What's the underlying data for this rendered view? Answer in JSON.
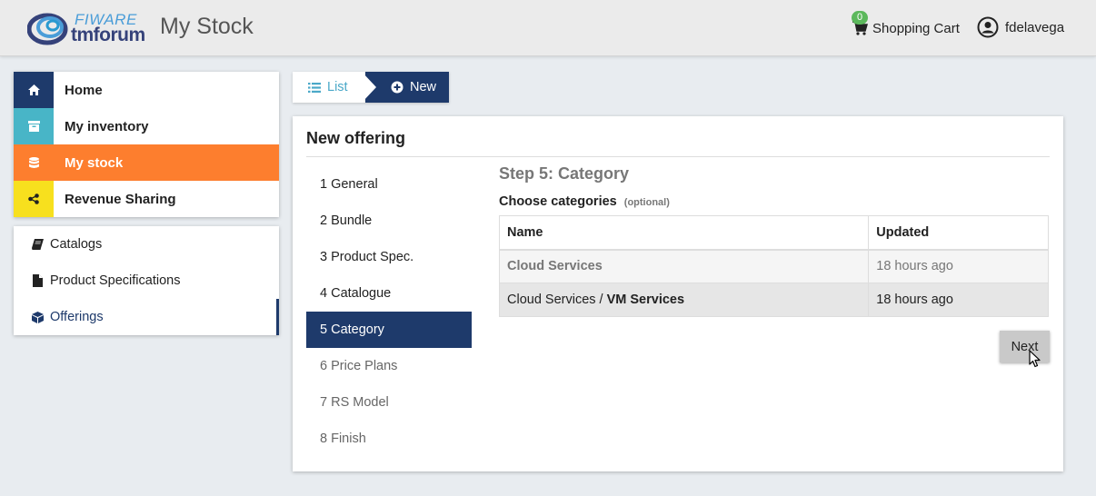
{
  "header": {
    "logo_top": "FIWARE",
    "logo_bottom": "tmforum",
    "title": "My Stock",
    "cart_count": "0",
    "cart_label": "Shopping Cart",
    "user_name": "fdelavega"
  },
  "sidebar": {
    "nav": [
      {
        "label": "Home",
        "icon": "home-icon",
        "color": "#1e3a6b"
      },
      {
        "label": "My inventory",
        "icon": "archive-icon",
        "color": "#48b5c7"
      },
      {
        "label": "My stock",
        "icon": "database-icon",
        "color": "#fd7e2e"
      },
      {
        "label": "Revenue Sharing",
        "icon": "share-icon",
        "color": "#f7e01e"
      }
    ],
    "sub": [
      {
        "label": "Catalogs",
        "icon": "book-icon"
      },
      {
        "label": "Product Specifications",
        "icon": "file-icon"
      },
      {
        "label": "Offerings",
        "icon": "cube-icon"
      }
    ]
  },
  "breadcrumb": {
    "list_label": "List",
    "new_label": "New"
  },
  "panel": {
    "title": "New offering",
    "steps": [
      "1 General",
      "2 Bundle",
      "3 Product Spec.",
      "4 Catalogue",
      "5 Category",
      "6 Price Plans",
      "7 RS Model",
      "8 Finish"
    ],
    "active_step": 5,
    "step_title": "Step 5: Category",
    "choose_label": "Choose categories",
    "optional_label": "(optional)",
    "table": {
      "headers": [
        "Name",
        "Updated"
      ],
      "rows": [
        {
          "parent": "",
          "name": "Cloud Services",
          "updated": "18 hours ago"
        },
        {
          "parent": "Cloud Services / ",
          "name": "VM Services",
          "updated": "18 hours ago"
        }
      ]
    },
    "next_label": "Next"
  },
  "colors": {
    "primary": "#1e3a6b",
    "accent": "#fd7e2e",
    "teal": "#48b5c7",
    "yellow": "#f7e01e",
    "badge": "#5cb85c"
  }
}
